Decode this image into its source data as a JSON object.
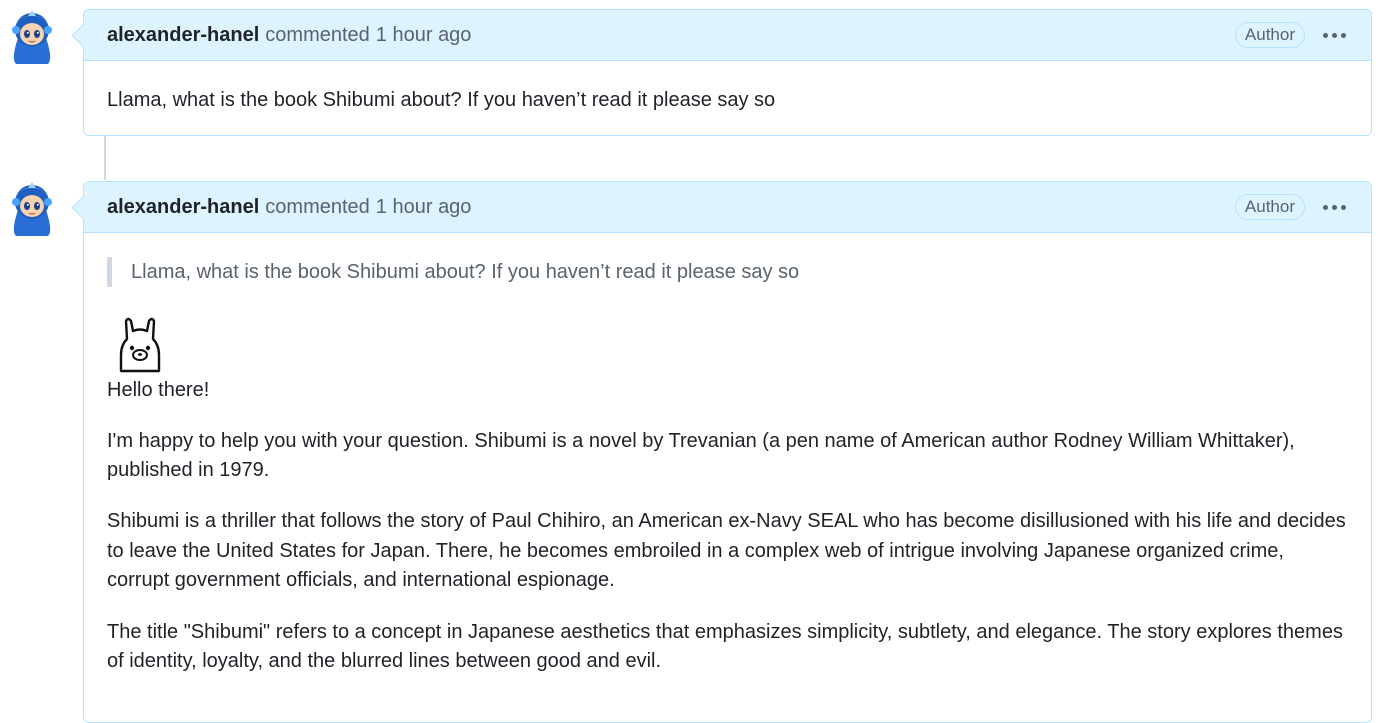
{
  "comments": [
    {
      "author": "alexander-hanel",
      "action": "commented",
      "time": "1 hour ago",
      "badge": "Author",
      "body": "Llama, what is the book Shibumi about? If you haven’t read it please say so"
    },
    {
      "author": "alexander-hanel",
      "action": "commented",
      "time": "1 hour ago",
      "badge": "Author",
      "quote": "Llama, what is the book Shibumi about? If you haven’t read it please say so",
      "paragraphs": [
        "Hello there!",
        "I'm happy to help you with your question. Shibumi is a novel by Trevanian (a pen name of American author Rodney William Whittaker), published in 1979.",
        "Shibumi is a thriller that follows the story of Paul Chihiro, an American ex-Navy SEAL who has become disillusioned with his life and decides to leave the United States for Japan. There, he becomes embroiled in a complex web of intrigue involving Japanese organized crime, corrupt government officials, and international espionage.",
        "The title \"Shibumi\" refers to a concept in Japanese aesthetics that emphasizes simplicity, subtlety, and elegance. The story explores themes of identity, loyalty, and the blurred lines between good and evil."
      ]
    }
  ],
  "colors": {
    "header_bg": "#ddf4ff",
    "border": "#b6e3ff",
    "muted_text": "#59636e"
  },
  "icons": {
    "avatar": "megaman-avatar",
    "ollama_logo": "llama-icon",
    "menu": "kebab-horizontal-icon"
  }
}
